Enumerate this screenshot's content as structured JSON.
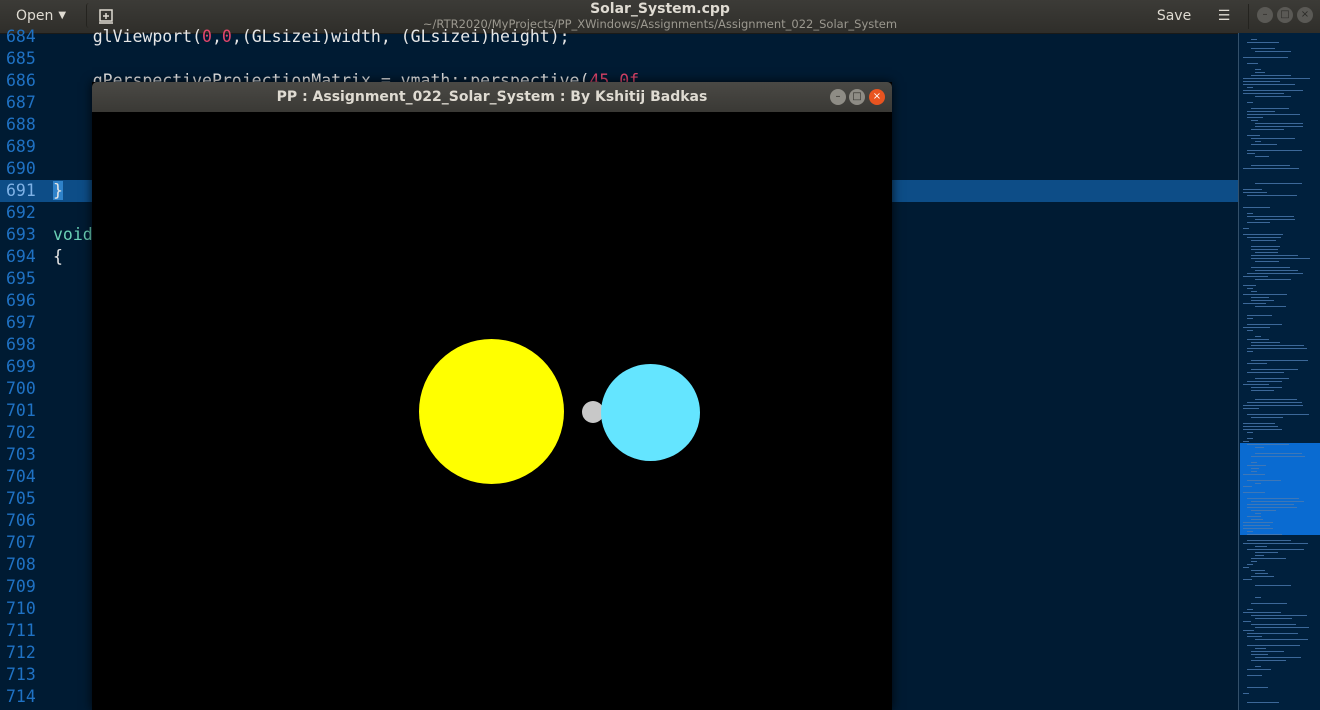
{
  "header": {
    "open_label": "Open",
    "save_label": "Save",
    "title": "Solar_System.cpp",
    "subtitle": "~/RTR2020/MyProjects/PP_XWindows/Assignments/Assignment_022_Solar_System"
  },
  "editor": {
    "line_numbers": [
      "684",
      "685",
      "686",
      "687",
      "688",
      "689",
      "690",
      "691",
      "692",
      "693",
      "694",
      "695",
      "696",
      "697",
      "698",
      "699",
      "700",
      "701",
      "702",
      "703",
      "704",
      "705",
      "706",
      "707",
      "708",
      "709",
      "710",
      "711",
      "712",
      "713",
      "714"
    ],
    "current_line": "691",
    "code": {
      "l684_a": "    glViewport(",
      "l684_n1": "0",
      "l684_c": ",",
      "l684_n2": "0",
      "l684_b": ",(GLsizei)width, (GLsizei)height);",
      "l686_a": "    gPerspectiveProjectionMatrix = vmath::perspective(",
      "l686_n": "45.0f",
      "l691": "}",
      "l693": "void",
      "l694": "{"
    }
  },
  "gl_window": {
    "title": "PP : Assignment_022_Solar_System : By Kshitij Badkas",
    "controls": {
      "minimize": "–",
      "maximize": "□",
      "close": "×"
    },
    "scene": {
      "sun_color": "#ffff00",
      "earth_color": "#64e5ff",
      "moon_color": "#c8c8c8",
      "background": "#000000"
    }
  },
  "colors": {
    "editor_bg": "#001b33",
    "line_number": "#1f72c4",
    "current_line_bg": "#0d4d87",
    "keyword": "#6ad1b6",
    "number": "#e0456b",
    "minimap_viewport": "#0a6bd1"
  }
}
